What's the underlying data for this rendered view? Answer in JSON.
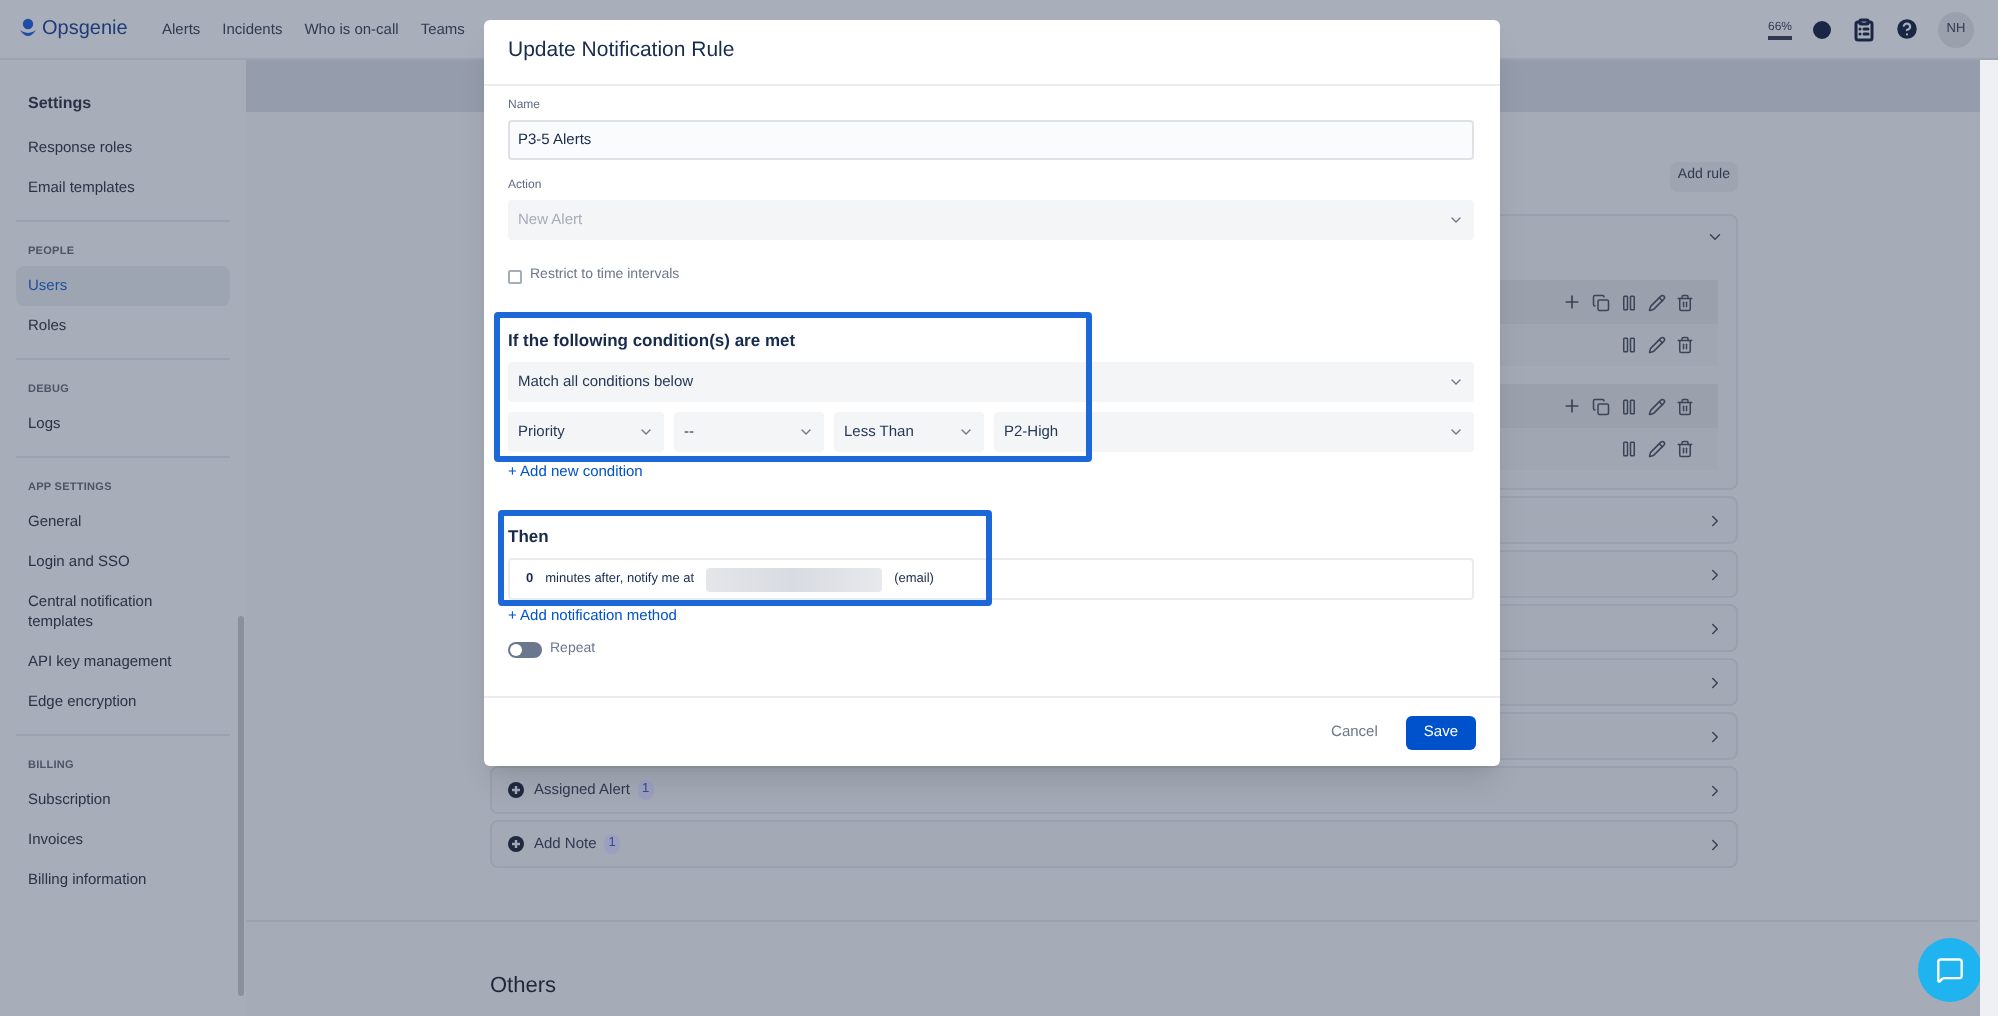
{
  "topbar": {
    "logo": "Opsgenie",
    "nav": [
      "Alerts",
      "Incidents",
      "Who is on-call",
      "Teams"
    ],
    "usage": "66%",
    "avatar": "NH"
  },
  "sidebar": {
    "title": "Settings",
    "groups": [
      {
        "items": [
          {
            "label": "Response roles",
            "selected": false
          },
          {
            "label": "Email templates",
            "selected": false
          }
        ]
      },
      {
        "heading": "PEOPLE",
        "items": [
          {
            "label": "Users",
            "selected": true
          },
          {
            "label": "Roles",
            "selected": false
          }
        ]
      },
      {
        "heading": "DEBUG",
        "items": [
          {
            "label": "Logs",
            "selected": false
          }
        ]
      },
      {
        "heading": "APP SETTINGS",
        "items": [
          {
            "label": "General",
            "selected": false
          },
          {
            "label": "Login and SSO",
            "selected": false
          },
          {
            "label": "Central notification templates",
            "selected": false
          },
          {
            "label": "API key management",
            "selected": false
          },
          {
            "label": "Edge encryption",
            "selected": false
          }
        ]
      },
      {
        "heading": "BILLING",
        "items": [
          {
            "label": "Subscription",
            "selected": false
          },
          {
            "label": "Invoices",
            "selected": false
          },
          {
            "label": "Billing information",
            "selected": false
          }
        ]
      }
    ]
  },
  "main": {
    "add_rule": "Add rule",
    "expanded_rows": [
      {
        "kind": "header"
      },
      {
        "kind": "item"
      },
      {
        "kind": "header"
      },
      {
        "kind": "item"
      }
    ],
    "rule_rows": [
      {
        "kind": "covered"
      },
      {
        "kind": "covered"
      },
      {
        "kind": "covered"
      },
      {
        "kind": "covered"
      },
      {
        "kind": "covered"
      },
      {
        "kind": "titled",
        "title": "Assigned Alert",
        "count": "1"
      },
      {
        "kind": "titled",
        "title": "Add Note",
        "count": "1"
      }
    ],
    "section_heading": "Others"
  },
  "dialog": {
    "title": "Update Notification Rule",
    "name_label": "Name",
    "name_value": "P3-5 Alerts",
    "action_label": "Action",
    "action_value": "New Alert",
    "action_disabled": true,
    "restrict": {
      "label": "Restrict to time intervals",
      "checked": false
    },
    "conditions_heading": "If the following condition(s) are met",
    "match": "Match all conditions below",
    "condition": [
      "Priority",
      "--",
      "Less Than",
      "P2-High"
    ],
    "add_condition": "+ Add new condition",
    "then_heading": "Then",
    "notify": {
      "minutes": "0",
      "text": "minutes after, notify me at",
      "suffix": "(email)"
    },
    "add_method": "+ Add notification method",
    "repeat": {
      "label": "Repeat",
      "on": false
    },
    "cancel": "Cancel",
    "save": "Save"
  }
}
